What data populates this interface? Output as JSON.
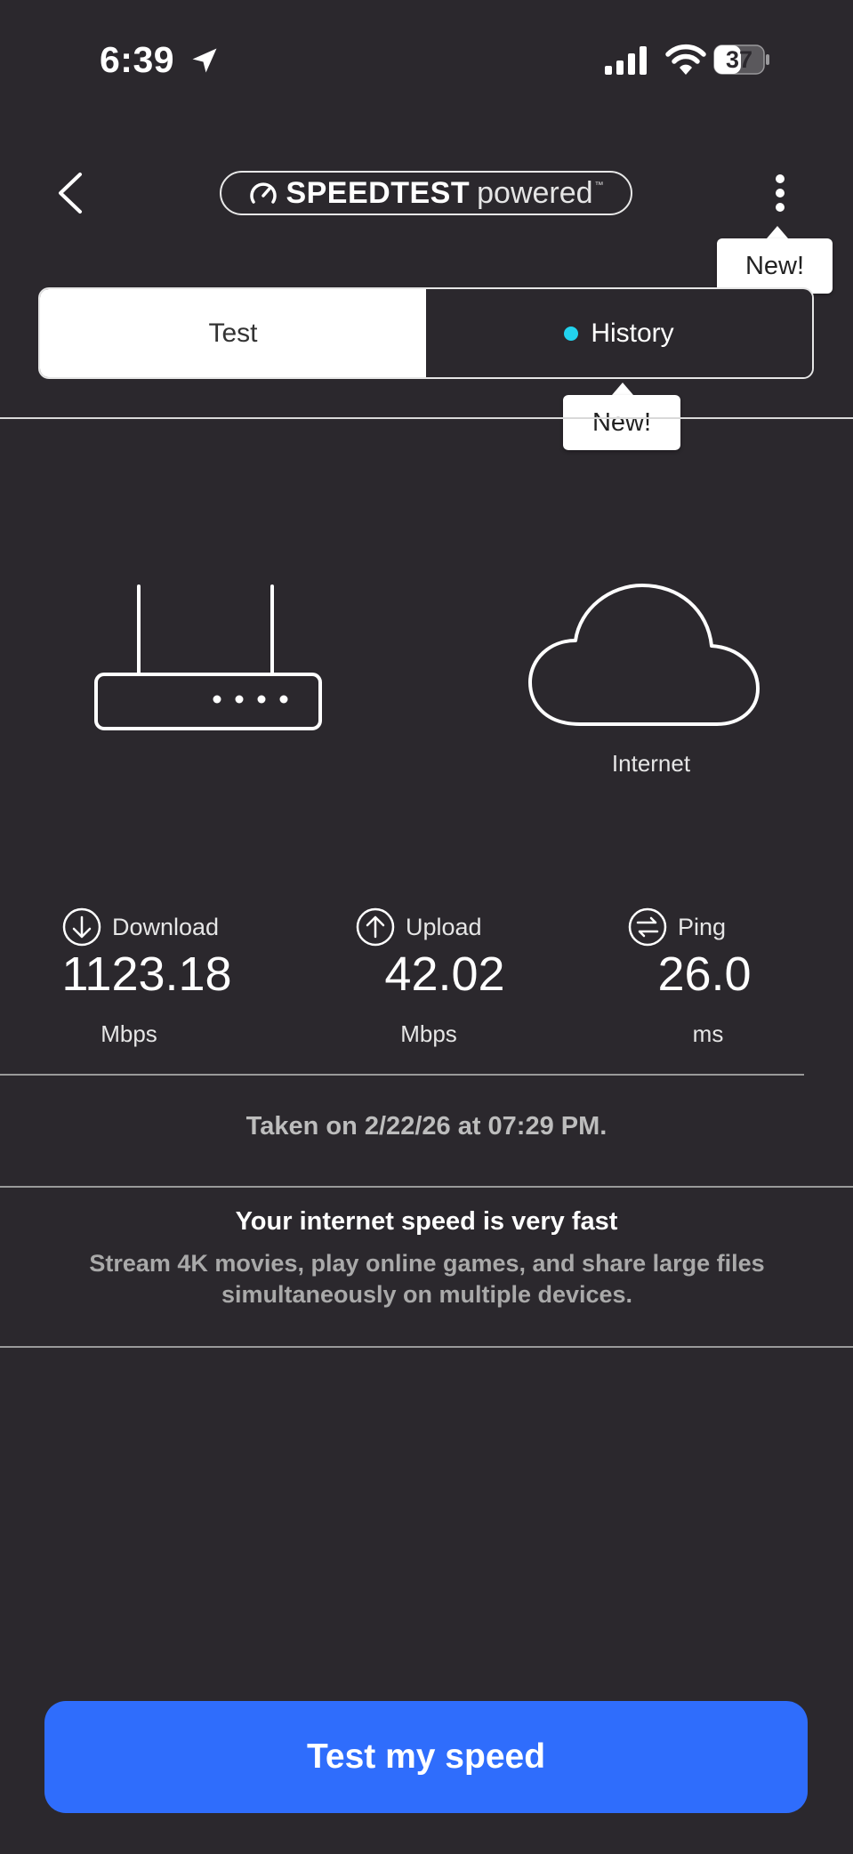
{
  "status_bar": {
    "time": "6:39",
    "battery": "37"
  },
  "header": {
    "logo_bold": "SPEEDTEST",
    "logo_light": "powered",
    "logo_tm": "™"
  },
  "tooltips": {
    "menu": "New!",
    "history": "New!"
  },
  "tabs": [
    {
      "label": "Test",
      "active": true
    },
    {
      "label": "History",
      "active": false
    }
  ],
  "network": {
    "internet_label": "Internet"
  },
  "metrics": {
    "download": {
      "label": "Download",
      "value": "1123.18",
      "unit": "Mbps"
    },
    "upload": {
      "label": "Upload",
      "value": "42.02",
      "unit": "Mbps"
    },
    "ping": {
      "label": "Ping",
      "value": "26.0",
      "unit": "ms"
    }
  },
  "taken": "Taken on 2/22/26 at 07:29 PM.",
  "verdict": {
    "title": "Your internet speed is very fast",
    "description": "Stream 4K movies, play online games, and share large files simultaneously on multiple devices."
  },
  "cta": {
    "label": "Test my speed"
  },
  "colors": {
    "background": "#2b282d",
    "accent": "#2f6dfc",
    "history_dot": "#22d3ee"
  }
}
